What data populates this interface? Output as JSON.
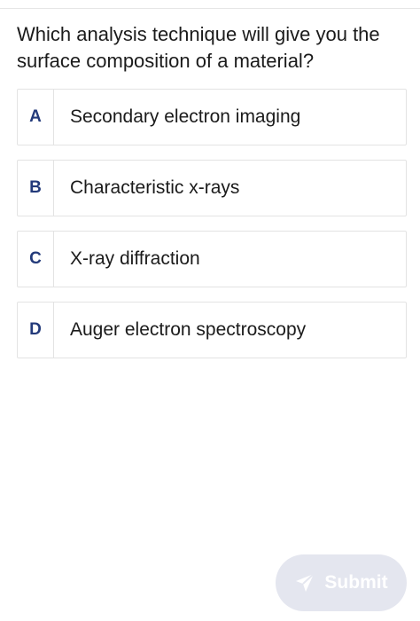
{
  "question": {
    "text": "Which analysis technique will give you the surface composition of a material?"
  },
  "options": [
    {
      "letter": "A",
      "label": "Secondary electron imaging"
    },
    {
      "letter": "B",
      "label": "Characteristic x-rays"
    },
    {
      "letter": "C",
      "label": "X-ray diffraction"
    },
    {
      "letter": "D",
      "label": "Auger electron spectroscopy"
    }
  ],
  "submit": {
    "label": "Submit",
    "icon": "paper-plane-icon",
    "enabled": false
  },
  "colors": {
    "letter": "#233a7a",
    "submit_bg_disabled": "#e4e6ef",
    "border": "#e3e3e3"
  }
}
